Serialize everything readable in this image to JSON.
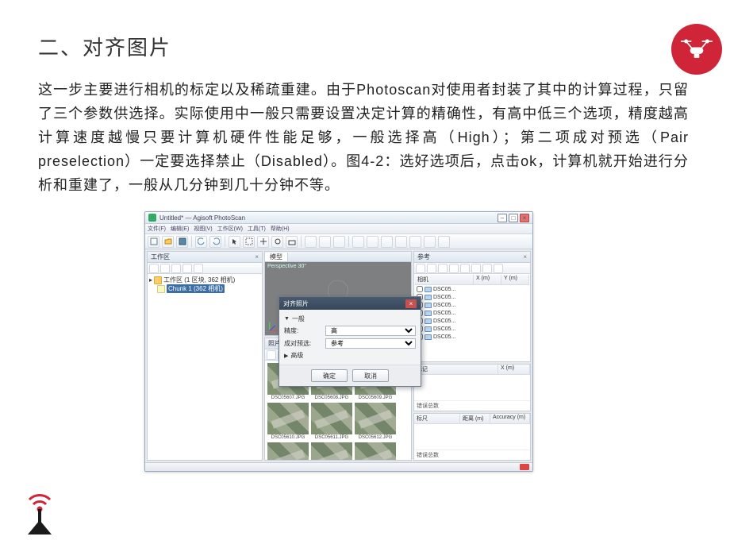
{
  "slide": {
    "title": "二、对齐图片",
    "body": "这一步主要进行相机的标定以及稀疏重建。由于Photoscan对使用者封装了其中的计算过程，只留了三个参数供选择。实际使用中一般只需要设置决定计算的精确性，有高中低三个选项，精度越高计算速度越慢只要计算机硬件性能足够，一般选择高（High）；第二项成对预选（Pair preselection）一定要选择禁止（Disabled）。图4-2：选好选项后，点击ok，计算机就开始进行分析和重建了，一般从几分钟到几十分钟不等。"
  },
  "app": {
    "title": "Untitled* — Agisoft PhotoScan",
    "menus": [
      "文件(F)",
      "编辑(E)",
      "视图(V)",
      "工作区(W)",
      "工具(T)",
      "帮助(H)"
    ],
    "workspace": {
      "title": "工作区",
      "root": "工作区 (1 区块, 362 相机)",
      "chunk": "Chunk 1 (362 相机)"
    },
    "viewport": {
      "tab": "模型",
      "label": "Perspective 30°"
    },
    "photos": {
      "title": "照片",
      "items": [
        "DSC05607.JPG",
        "DSC05608.JPG",
        "DSC05609.JPG",
        "DSC05610.JPG",
        "DSC05611.JPG",
        "DSC05612.JPG",
        "",
        "",
        ""
      ]
    },
    "reference": {
      "title": "参考",
      "cameras_hdr": [
        "相机",
        "X (m)",
        "Y (m)"
      ],
      "cameras": [
        "DSC05...",
        "DSC05...",
        "DSC05...",
        "DSC05...",
        "DSC05...",
        "DSC05...",
        "DSC05..."
      ],
      "markers_hdr": [
        "标记",
        "X (m)"
      ],
      "err_label": "错误总数",
      "scale_hdr": [
        "标尺",
        "距离 (m)",
        "Accuracy (m)"
      ]
    },
    "dialog": {
      "title": "对齐照片",
      "section_general": "一般",
      "accuracy_label": "精度:",
      "accuracy_value": "高",
      "pair_label": "成对预选:",
      "pair_value": "参考",
      "section_advanced": "高级",
      "ok": "确定",
      "cancel": "取消"
    }
  }
}
